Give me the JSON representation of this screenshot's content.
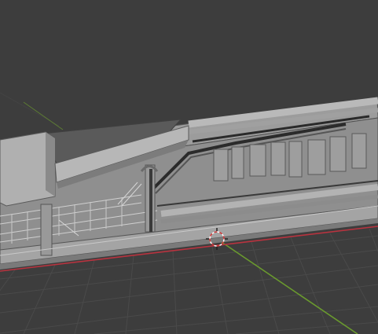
{
  "viewport": {
    "background": "#3d3d3d",
    "grid_color": "#4a4a4a",
    "x_axis_color": "#b8333f",
    "y_axis_color": "#6a9a2e",
    "model_color": "#a8a8a8",
    "model_shadow": "#6e6e6e"
  },
  "cursor": {
    "icon": "3d-cursor-icon"
  }
}
